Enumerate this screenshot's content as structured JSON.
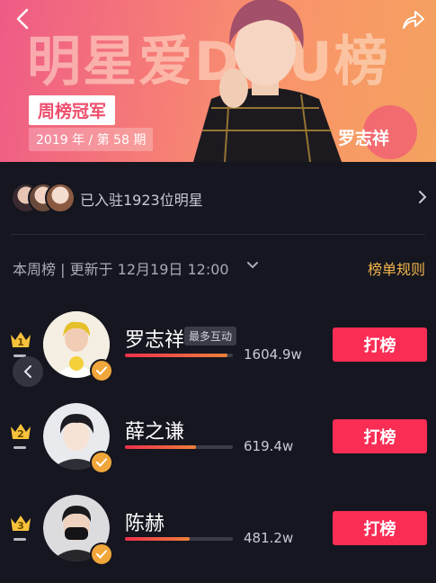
{
  "banner": {
    "big_title": "明星爱DOU榜",
    "badge_title": "周榜冠军",
    "period": "2019 年 / 第 58 期",
    "star_name": "罗志祥",
    "back_icon": "chevron-left-icon",
    "share_icon": "share-arrow-icon"
  },
  "joined": {
    "text": "已入驻1923位明星",
    "chevron_icon": "chevron-right-icon"
  },
  "update": {
    "text": "本周榜 | 更新于 12月19日 12:00",
    "rules_label": "榜单规则"
  },
  "ranking": [
    {
      "rank": "1",
      "name": "罗志祥",
      "tag": "最多互动",
      "score": "1604.9w",
      "progress": 0.95,
      "button": "打榜"
    },
    {
      "rank": "2",
      "name": "薛之谦",
      "tag": "",
      "score": "619.4w",
      "progress": 0.66,
      "button": "打榜"
    },
    {
      "rank": "3",
      "name": "陈赫",
      "tag": "",
      "score": "481.2w",
      "progress": 0.6,
      "button": "打榜"
    }
  ],
  "colors": {
    "accent": "#fa2d55",
    "gold": "#f3b44a",
    "background": "#15161f"
  }
}
